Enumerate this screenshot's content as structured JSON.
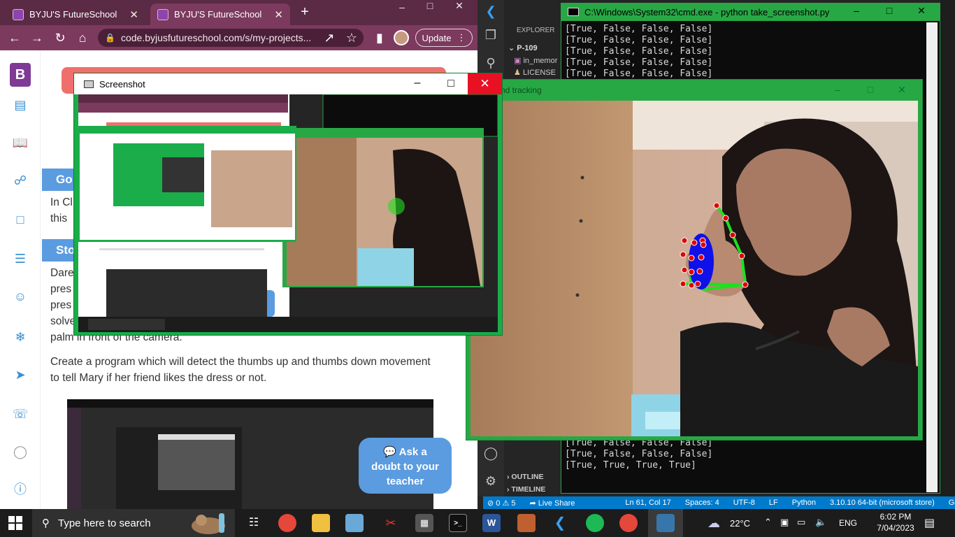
{
  "chrome": {
    "tabs": [
      {
        "label": "BYJU'S FutureSchool"
      },
      {
        "label": "BYJU'S FutureSchool"
      }
    ],
    "url": "code.byjusfutureschool.com/s/my-projects...",
    "update_label": "Update"
  },
  "page": {
    "section1_head": "Go",
    "section1_text": "In Cl",
    "section1_text2": "this",
    "section2_head": "Sto",
    "story_lines": [
      "Dare",
      "pres",
      "pres",
      "solve",
      "palm in front of the camera."
    ],
    "program_text": "Create a program which will detect the thumbs up and thumbs down movement to tell Mary if her friend likes the dress or not.",
    "ask_label_1": "Ask a",
    "ask_label_2": "doubt to your",
    "ask_label_3": "teacher"
  },
  "vscode": {
    "explorer_label": "EXPLORER",
    "project_folder": "P-109",
    "file1": "in_memor",
    "file2": "LICENSE",
    "outline_label": "OUTLINE",
    "timeline_label": "TIMELINE",
    "status": {
      "problems": "⊘ 0 ⚠ 5",
      "live_share": "Live Share",
      "position": "Ln 61, Col 17",
      "spaces": "Spaces: 4",
      "encoding": "UTF-8",
      "eol": "LF",
      "language": "Python",
      "interpreter": "3.10.10 64-bit (microsoft store)",
      "go_live": "Go Live"
    }
  },
  "cmd": {
    "title": "C:\\Windows\\System32\\cmd.exe - python  take_screenshot.py",
    "lines_top": [
      "[True, False, False, False]",
      "[True, False, False, False]",
      "[True, False, False, False]",
      "[True, False, False, False]",
      "[True, False, False, False]"
    ],
    "lines_bottom": [
      "[True, False, False, False]",
      "[True, False, False, False]",
      "[True, True, True, True]"
    ]
  },
  "hand_window": {
    "title": "nd tracking"
  },
  "screenshot_window": {
    "title": "Screenshot"
  },
  "taskbar": {
    "search_placeholder": "Type here to search",
    "weather": "22°C",
    "language": "ENG",
    "time": "6:02 PM",
    "date": "7/04/2023"
  }
}
